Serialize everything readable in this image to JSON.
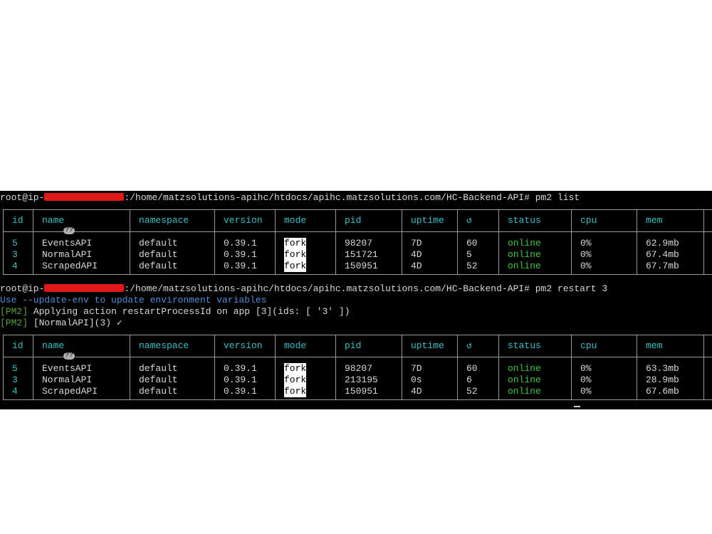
{
  "terminal": {
    "prompt1": {
      "user": "root@ip-",
      "path": ":/home/matzsolutions-apihc/htdocs/apihc.matzsolutions.com/HC-Backend-API#",
      "command": " pm2 list"
    },
    "prompt2": {
      "user": "root@ip-",
      "path": ":/home/matzsolutions-apihc/htdocs/apihc.matzsolutions.com/HC-Backend-API#",
      "command": " pm2 restart 3"
    },
    "hint": "Use --update-env to update environment variables",
    "log1": {
      "tag": "[PM2]",
      "text": " Applying action restartProcessId on app [3](ids: [ '3' ])"
    },
    "log2": {
      "tag": "[PM2]",
      "text": " [NormalAPI](3) ✓"
    }
  },
  "table_headers": [
    "id",
    "name",
    "namespace",
    "version",
    "mode",
    "pid",
    "uptime",
    "↺",
    "status",
    "cpu",
    "mem"
  ],
  "tables": [
    {
      "rows": [
        {
          "id": "5",
          "name": "EventsAPI",
          "namespace": "default",
          "version": "0.39.1",
          "mode": "fork",
          "pid": "98207",
          "uptime": "7D",
          "restarts": "60",
          "status": "online",
          "cpu": "0%",
          "mem": "62.9mb"
        },
        {
          "id": "3",
          "name": "NormalAPI",
          "namespace": "default",
          "version": "0.39.1",
          "mode": "fork",
          "pid": "151721",
          "uptime": "4D",
          "restarts": "5",
          "status": "online",
          "cpu": "0%",
          "mem": "67.4mb"
        },
        {
          "id": "4",
          "name": "ScrapedAPI",
          "namespace": "default",
          "version": "0.39.1",
          "mode": "fork",
          "pid": "150951",
          "uptime": "4D",
          "restarts": "52",
          "status": "online",
          "cpu": "0%",
          "mem": "67.7mb"
        }
      ]
    },
    {
      "rows": [
        {
          "id": "5",
          "name": "EventsAPI",
          "namespace": "default",
          "version": "0.39.1",
          "mode": "fork",
          "pid": "98207",
          "uptime": "7D",
          "restarts": "60",
          "status": "online",
          "cpu": "0%",
          "mem": "63.3mb"
        },
        {
          "id": "3",
          "name": "NormalAPI",
          "namespace": "default",
          "version": "0.39.1",
          "mode": "fork",
          "pid": "213195",
          "uptime": "0s",
          "restarts": "6",
          "status": "online",
          "cpu": "0%",
          "mem": "28.9mb"
        },
        {
          "id": "4",
          "name": "ScrapedAPI",
          "namespace": "default",
          "version": "0.39.1",
          "mode": "fork",
          "pid": "150951",
          "uptime": "4D",
          "restarts": "52",
          "status": "online",
          "cpu": "0%",
          "mem": "67.6mb"
        }
      ]
    }
  ],
  "colors": {
    "background": "#000000",
    "text": "#d9d9d9",
    "header": "#39c0c8",
    "online": "#3dc83d",
    "hint": "#4f8fd6",
    "pm2_tag": "#5ba03a",
    "redaction": "#e01818"
  }
}
